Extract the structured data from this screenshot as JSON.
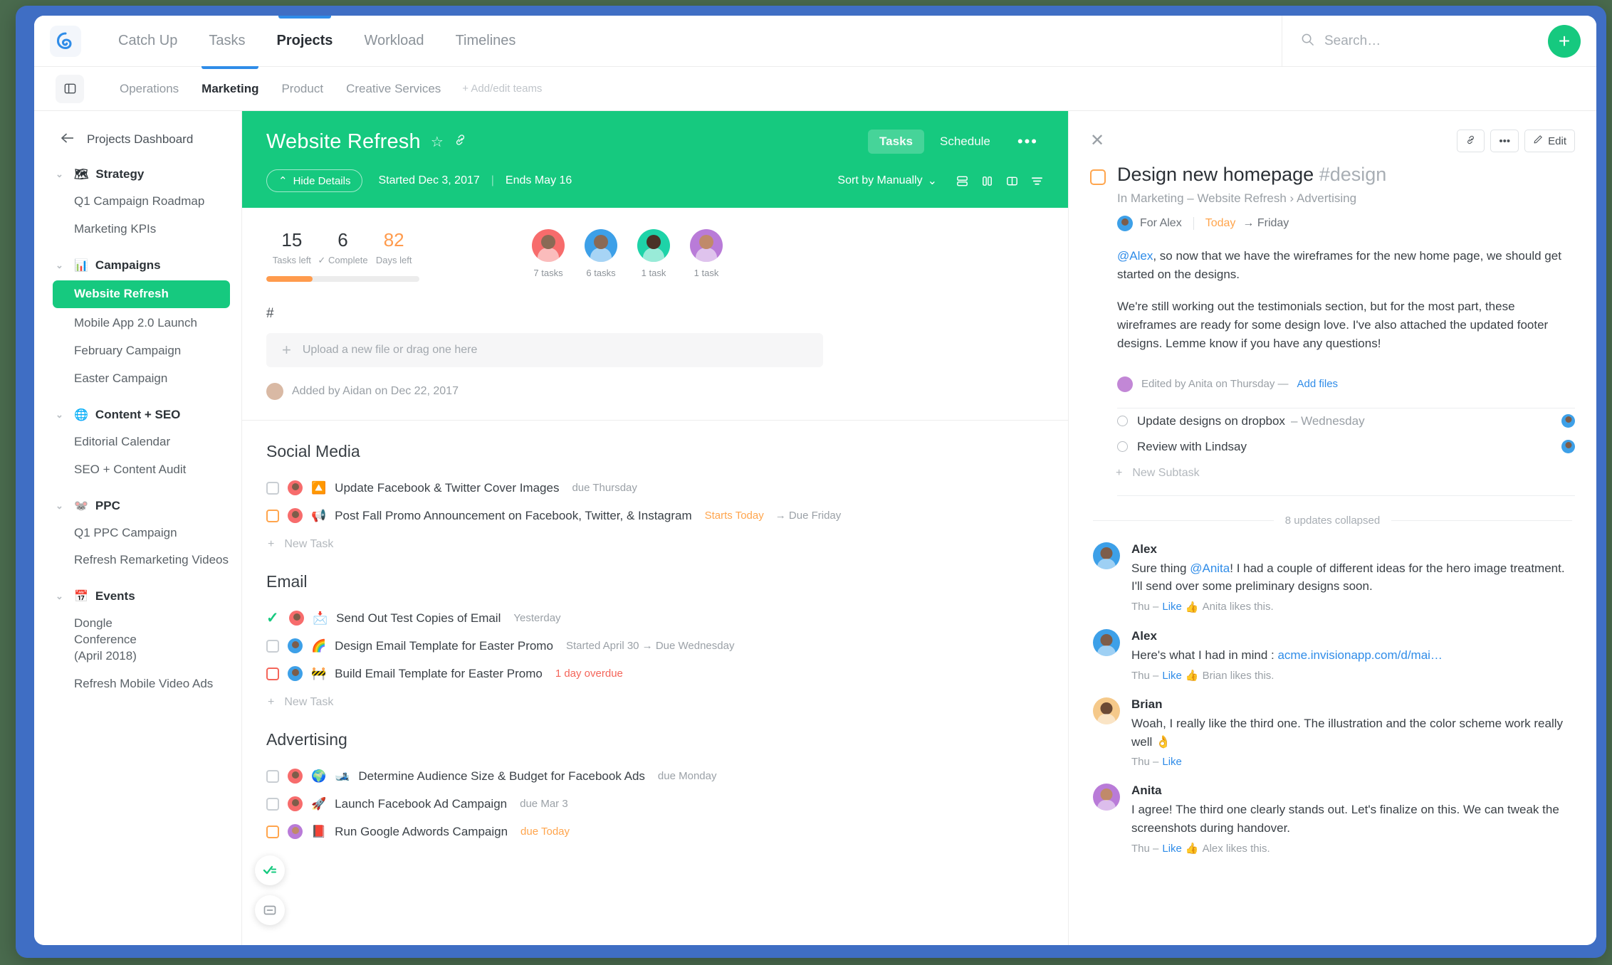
{
  "topnav": {
    "logo": "app-logo",
    "items": [
      {
        "label": "Catch Up",
        "active": false
      },
      {
        "label": "Tasks",
        "active": false
      },
      {
        "label": "Projects",
        "active": true
      },
      {
        "label": "Workload",
        "active": false
      },
      {
        "label": "Timelines",
        "active": false
      }
    ],
    "search_placeholder": "Search…",
    "search_value": "",
    "add_label": "+"
  },
  "teambar": {
    "items": [
      {
        "label": "Operations",
        "active": false
      },
      {
        "label": "Marketing",
        "active": true
      },
      {
        "label": "Product",
        "active": false
      },
      {
        "label": "Creative Services",
        "active": false
      }
    ],
    "add_teams": "+ Add/edit teams"
  },
  "sidebar": {
    "back": "Projects Dashboard",
    "groups": [
      {
        "emoji": "🗺",
        "label": "Strategy",
        "items": [
          "Q1 Campaign Roadmap",
          "Marketing KPIs"
        ]
      },
      {
        "emoji": "📊",
        "label": "Campaigns",
        "items": [
          "Website Refresh",
          "Mobile App 2.0 Launch",
          "February Campaign",
          "Easter Campaign"
        ],
        "selected": "Website Refresh"
      },
      {
        "emoji": "🌐",
        "label": "Content + SEO",
        "items": [
          "Editorial Calendar",
          "SEO + Content Audit"
        ]
      },
      {
        "emoji": "🐭",
        "label": "PPC",
        "items": [
          "Q1 PPC Campaign",
          "Refresh Remarketing Videos"
        ]
      },
      {
        "emoji": "📅",
        "label": "Events",
        "items": [
          "Dongle Conference (April 2018)",
          "Refresh Mobile Video Ads"
        ]
      }
    ]
  },
  "project": {
    "title": "Website Refresh",
    "tabs": [
      {
        "label": "Tasks",
        "active": true
      },
      {
        "label": "Schedule",
        "active": false
      }
    ],
    "more": "•••",
    "hide_details": "Hide Details",
    "started": "Started Dec 3, 2017",
    "ends": "Ends May 16",
    "sort_by": "Sort by Manually",
    "accent_color": "#16c97f"
  },
  "stats": {
    "tasks_left_value": "15",
    "tasks_left_label": "Tasks left",
    "complete_value": "6",
    "complete_label": "Complete",
    "days_left_value": "82",
    "days_left_label": "Days left",
    "progress_percent": 30,
    "progress_color": "#ff9b4d",
    "people": [
      {
        "tasks": "7 tasks",
        "color": "#f76c6c"
      },
      {
        "tasks": "6 tasks",
        "color": "#3da0e8"
      },
      {
        "tasks": "1 task",
        "color": "#1ed3a8"
      },
      {
        "tasks": "1 task",
        "color": "#b97bd8"
      }
    ]
  },
  "description": {
    "hash": "#",
    "upload_text": "Upload a new file or drag one here",
    "added_by": "Added by Aidan on Dec 22, 2017"
  },
  "tasklists": [
    {
      "title": "Social Media",
      "tasks": [
        {
          "state": "open",
          "avatar_color": "#f76c6c",
          "emoji": "🔼",
          "name": "Update Facebook & Twitter Cover Images",
          "due": "due Thursday",
          "due_style": "gray"
        },
        {
          "state": "orange",
          "avatar_color": "#f76c6c",
          "emoji": "📢",
          "name": "Post Fall Promo Announcement on Facebook, Twitter, & Instagram",
          "due": "Starts Today",
          "due2": "→ Due Friday",
          "due_style": "orange"
        }
      ],
      "new_task": "New Task"
    },
    {
      "title": "Email",
      "tasks": [
        {
          "state": "done",
          "avatar_color": "#f76c6c",
          "emoji": "📩",
          "name": "Send Out Test Copies of Email",
          "due": "Yesterday",
          "due_style": "gray"
        },
        {
          "state": "open",
          "avatar_color": "#3da0e8",
          "emoji": "🌈",
          "name": "Design Email Template for Easter Promo",
          "due": "Started April 30 → Due Wednesday",
          "due_style": "gray"
        },
        {
          "state": "red",
          "avatar_color": "#3da0e8",
          "emoji": "🚧",
          "name": "Build Email Template for Easter Promo",
          "due": "1 day overdue",
          "due_style": "red"
        }
      ],
      "new_task": "New Task"
    },
    {
      "title": "Advertising",
      "tasks": [
        {
          "state": "open",
          "avatar_color": "#f76c6c",
          "emoji": "🌍",
          "emoji2": "🎿",
          "name": "Determine Audience Size & Budget for Facebook Ads",
          "due": "due Monday",
          "due_style": "gray"
        },
        {
          "state": "open",
          "avatar_color": "#f76c6c",
          "emoji": "🚀",
          "name": "Launch Facebook Ad Campaign",
          "due": "due Mar 3",
          "due_style": "gray"
        },
        {
          "state": "orange",
          "avatar_color": "#b97bd8",
          "emoji": "📕",
          "name": "Run Google Adwords Campaign",
          "due": "due Today",
          "due_style": "orange"
        }
      ]
    }
  ],
  "detail": {
    "close": "✕",
    "edit_label": "Edit",
    "more_label": "•••",
    "title": "Design new homepage",
    "tag": "#design",
    "breadcrumb": "In Marketing – Website Refresh › Advertising",
    "assignee": "For Alex",
    "date_start": "Today",
    "date_end": "→ Friday",
    "paragraph_1_mention": "@Alex",
    "paragraph_1": ", so now that we have the wireframes for the new home page, we should get started on the designs.",
    "paragraph_2": "We're still working out the testimonials section, but for the most part, these wireframes are ready for some design love. I've also attached the updated footer designs. Lemme know if you have any questions!",
    "edited_by": "Edited by Anita on Thursday —",
    "add_files": "Add files",
    "subtasks": [
      {
        "name": "Update designs on dropbox",
        "due": "– Wednesday",
        "avatar_color": "#3da0e8"
      },
      {
        "name": "Review with Lindsay",
        "due": "",
        "avatar_color": "#3da0e8"
      }
    ],
    "new_subtask": "New Subtask",
    "collapsed": "8 updates collapsed",
    "updates": [
      {
        "author": "Alex",
        "avatar_color": "#3da0e8",
        "text_before": "Sure thing ",
        "mention": "@Anita",
        "text_after": "! I had a couple of different ideas for the hero image treatment. I'll send over some preliminary designs soon.",
        "time": "Thu –",
        "like": "Like",
        "likes": "Anita likes this."
      },
      {
        "author": "Alex",
        "avatar_color": "#3da0e8",
        "text_before": "Here's what I had in mind : ",
        "link": "acme.invisionapp.com/d/mai…",
        "text_after": "",
        "time": "Thu –",
        "like": "Like",
        "likes": "Brian likes this."
      },
      {
        "author": "Brian",
        "avatar_color": "#f5c98a",
        "text_before": "Woah, I really like the third one. The illustration and the color scheme work really well 👌",
        "text_after": "",
        "time": "Thu –",
        "like": "Like",
        "likes": ""
      },
      {
        "author": "Anita",
        "avatar_color": "#b97bd8",
        "text_before": "I agree! The third one clearly stands out. Let's finalize on this. We can tweak the screenshots during handover.",
        "text_after": "",
        "time": "Thu –",
        "like": "Like",
        "likes": "Alex likes this."
      }
    ]
  },
  "floaters": [
    {
      "name": "my-tasks-icon"
    },
    {
      "name": "inbox-icon"
    }
  ]
}
